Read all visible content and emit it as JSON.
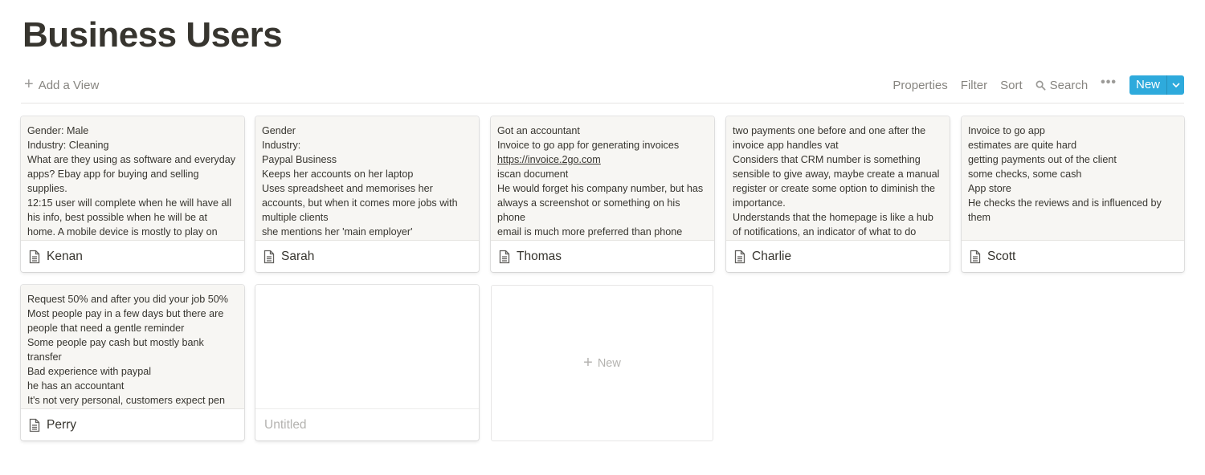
{
  "page": {
    "title": "Business Users"
  },
  "toolbar": {
    "add_view_label": "Add a View",
    "properties_label": "Properties",
    "filter_label": "Filter",
    "sort_label": "Sort",
    "search_label": "Search",
    "new_label": "New"
  },
  "colors": {
    "accent": "#2eaadc",
    "text": "#37352f",
    "muted": "#878580",
    "preview_bg": "#f7f6f3"
  },
  "cards": [
    {
      "title": "Kenan",
      "lines": [
        "Gender: Male",
        "Industry: Cleaning",
        "What are they using as software and everyday apps? Ebay app for buying and selling supplies.",
        "12:15 user will complete when he will have all his info, best possible when he will be at home. A mobile device is mostly to play on"
      ]
    },
    {
      "title": "Sarah",
      "lines": [
        "Gender",
        "Industry:",
        "Paypal Business",
        "Keeps her accounts on her laptop",
        "Uses spreadsheet and memorises her accounts, but when it comes more jobs with multiple clients",
        "she mentions her 'main employer'"
      ]
    },
    {
      "title": "Thomas",
      "lines": [
        "Got an accountant",
        "Invoice to go app for generating invoices",
        "https://invoice.2go.com",
        "iscan document",
        "He would forget his company number, but has always a screenshot or something on his phone",
        "email is much more preferred than phone"
      ]
    },
    {
      "title": "Charlie",
      "lines": [
        "two payments one before and one after the invoice app handles vat",
        "Considers that CRM number is something sensible to give away, maybe create a manual register or create some option to diminish the importance.",
        "Understands that the homepage is like a hub of notifications, an indicator of what to do"
      ]
    },
    {
      "title": "Scott",
      "lines": [
        "Invoice to go app",
        "estimates are quite hard",
        "getting payments out of the client",
        "some checks, some cash",
        "App store",
        "He checks the reviews and is influenced by them"
      ]
    },
    {
      "title": "Perry",
      "lines": [
        "Request 50% and after you did your job 50%",
        "Most people pay in a few days but there are people that need a gentle reminder",
        "Some people pay cash but mostly bank transfer",
        "Bad experience with paypal",
        "he has an accountant",
        "It's not very personal, customers expect pen"
      ]
    },
    {
      "title": "Untitled",
      "lines": []
    }
  ],
  "new_card": {
    "label": "New"
  }
}
